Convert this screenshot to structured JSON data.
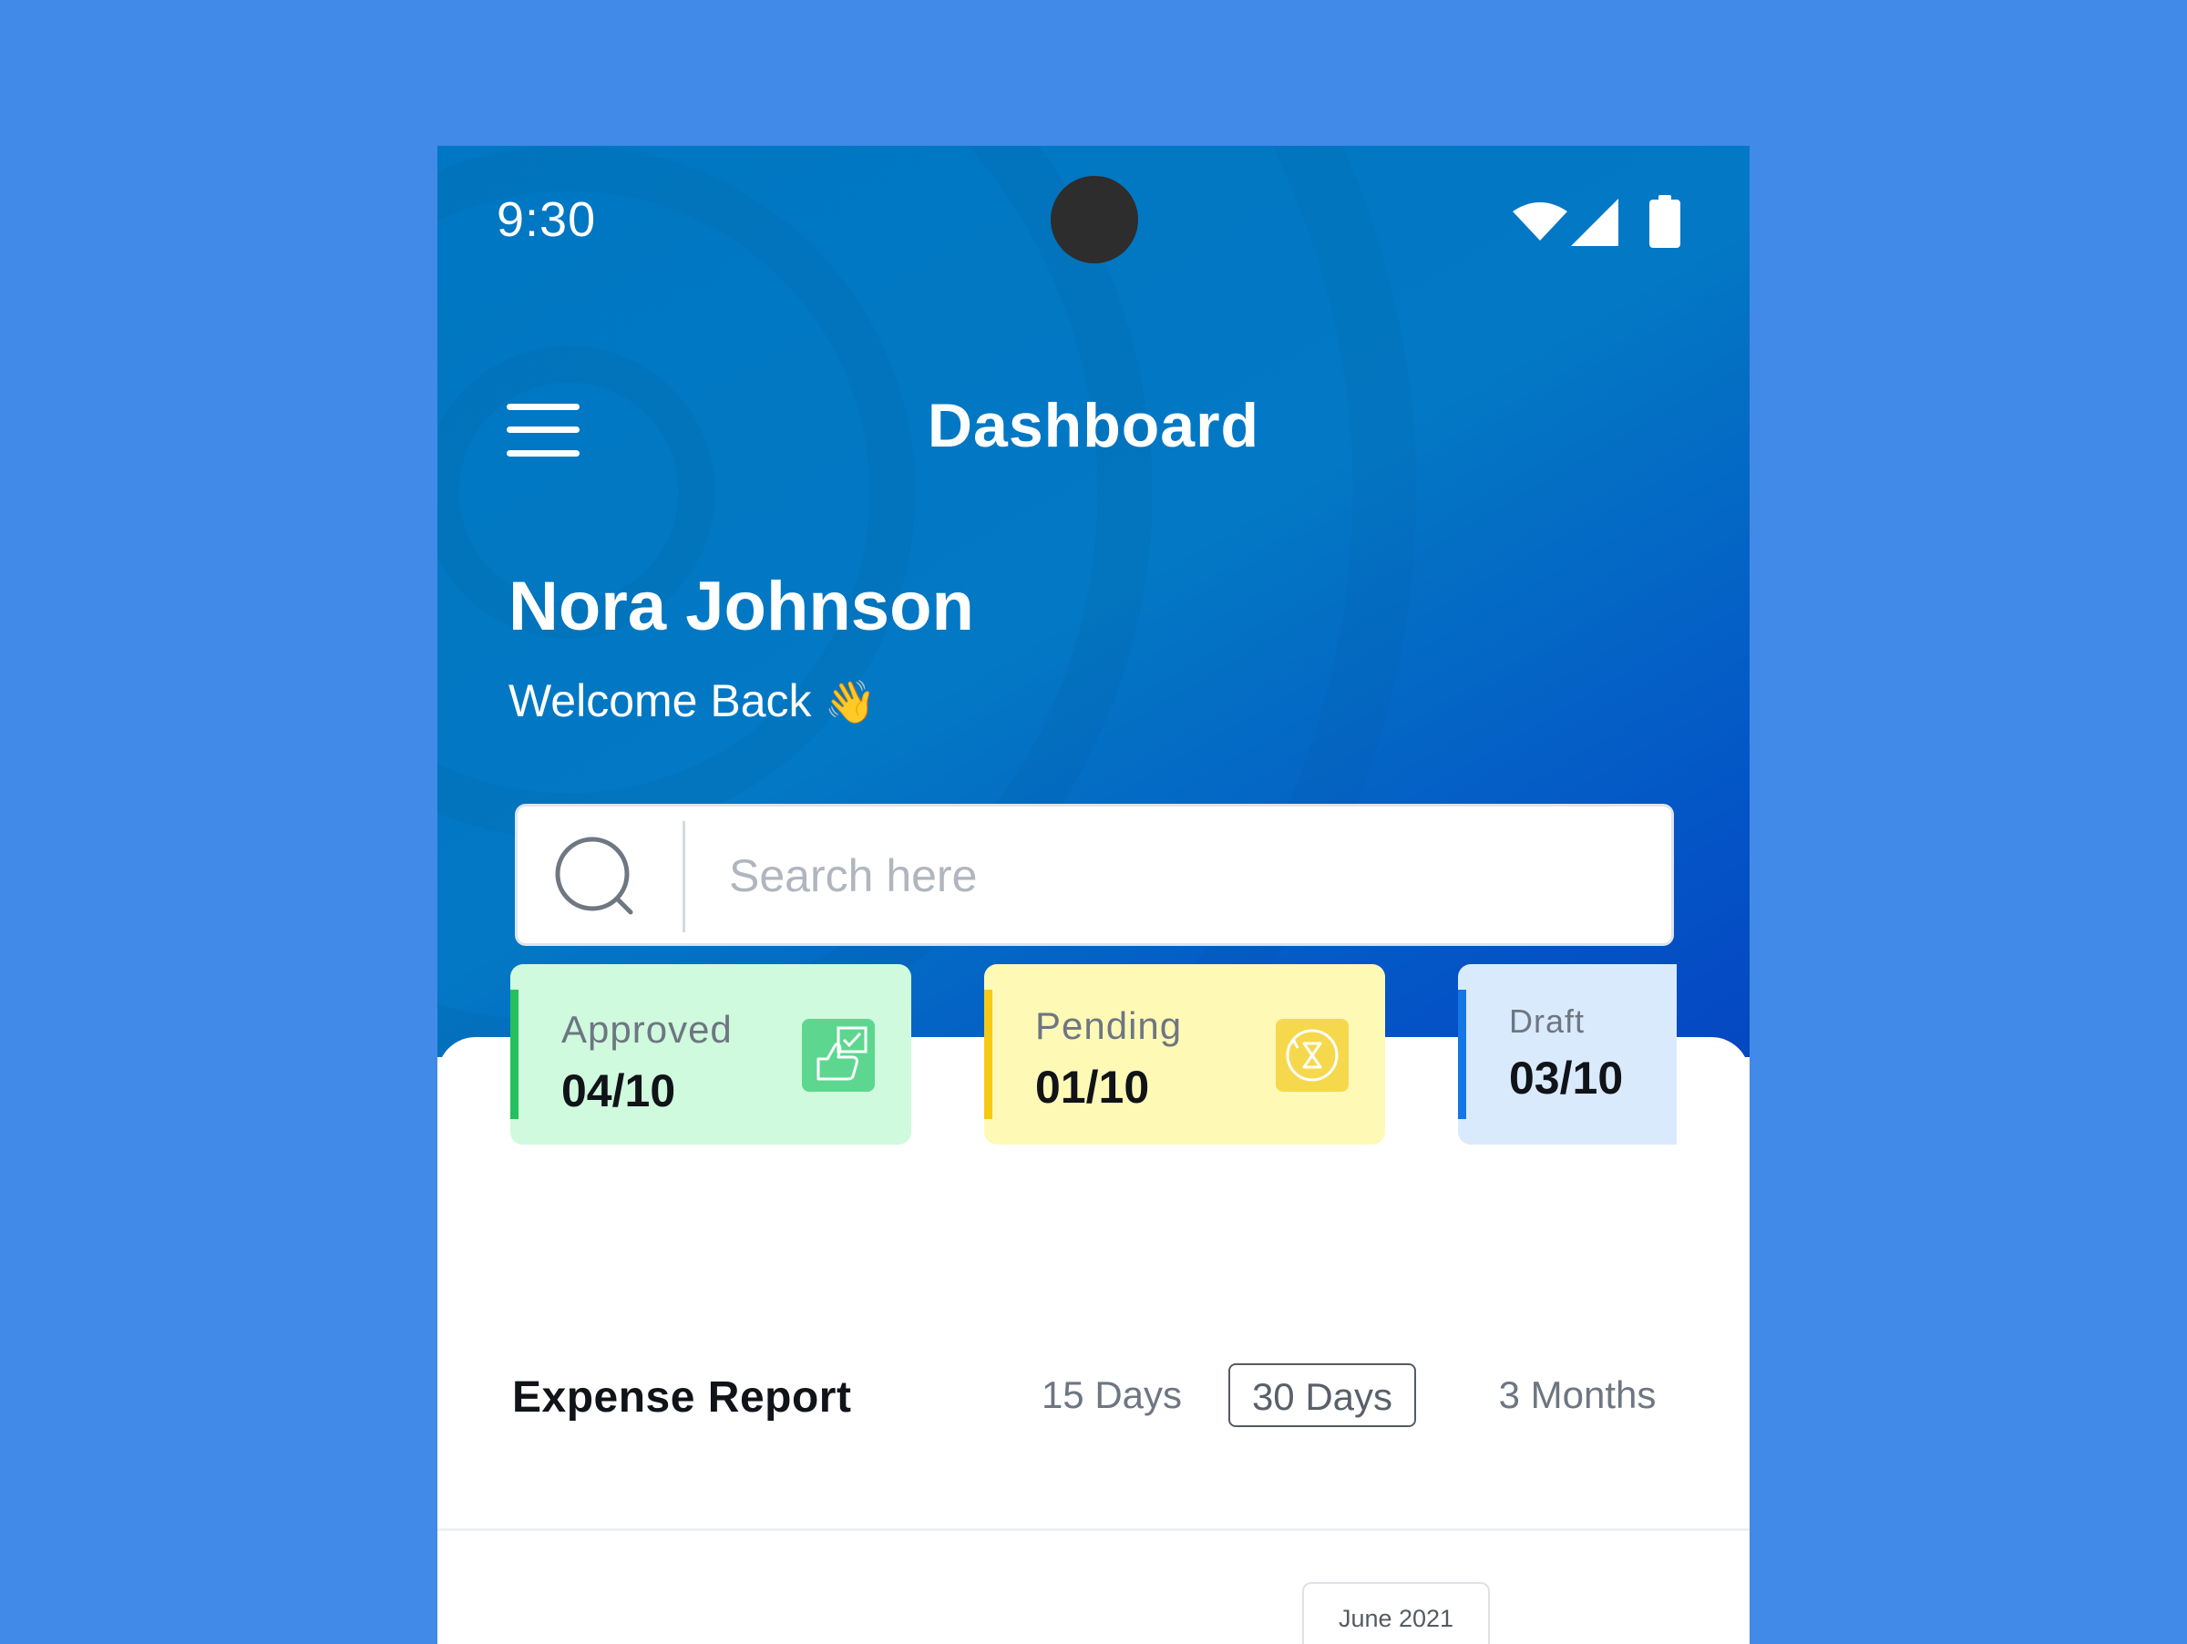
{
  "status_bar": {
    "time": "9:30"
  },
  "header": {
    "title": "Dashboard"
  },
  "user": {
    "name": "Nora Johnson",
    "welcome": "Welcome Back",
    "wave": "👋"
  },
  "search": {
    "placeholder": "Search here",
    "value": ""
  },
  "cards": {
    "approved": {
      "label": "Approved",
      "value": "04/10",
      "icon": "thumbs-up-check-icon",
      "color": "#25c05e"
    },
    "pending": {
      "label": "Pending",
      "value": "01/10",
      "icon": "hourglass-icon",
      "color": "#f6c917"
    },
    "draft": {
      "label": "Draft",
      "value": "03/10",
      "color": "#1477e6"
    }
  },
  "expense_report": {
    "title": "Expense Report",
    "ranges": [
      "15 Days",
      "30 Days",
      "3 Months"
    ],
    "selected": "30 Days",
    "month": "June 2021"
  },
  "colors": {
    "background": "#418ae8",
    "header_gradient_start": "#0077c2",
    "header_gradient_end": "#0547c2"
  }
}
